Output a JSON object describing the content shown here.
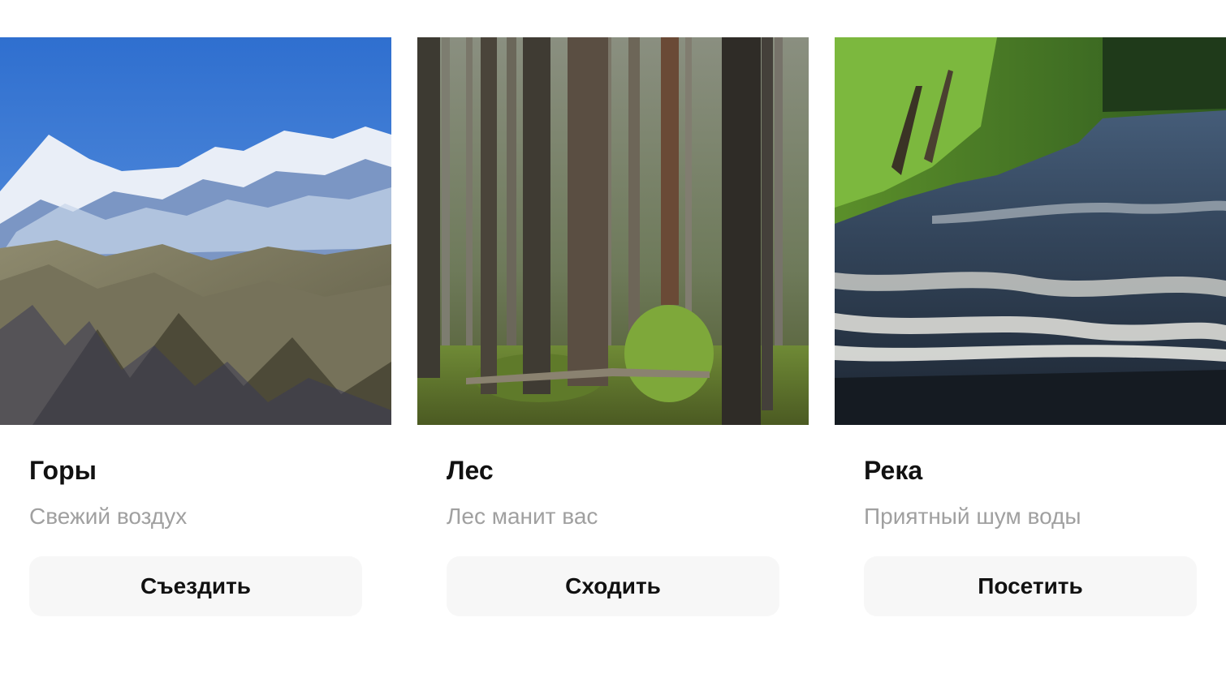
{
  "cards": [
    {
      "title": "Горы",
      "subtitle": "Свежий воздух",
      "button_label": "Съездить",
      "image": "mountains-photo"
    },
    {
      "title": "Лес",
      "subtitle": "Лес манит вас",
      "button_label": "Сходить",
      "image": "forest-photo"
    },
    {
      "title": "Река",
      "subtitle": "Приятный шум воды",
      "button_label": "Посетить",
      "image": "river-photo"
    }
  ],
  "colors": {
    "background": "#ffffff",
    "title": "#111111",
    "subtitle": "#a0a0a0",
    "button_background": "#f7f7f7"
  }
}
